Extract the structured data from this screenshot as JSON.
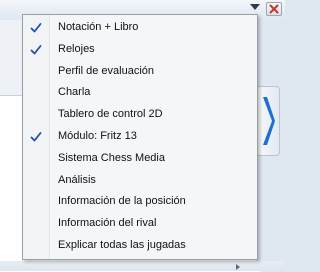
{
  "menu": {
    "items": [
      {
        "label": "Notación + Libro",
        "checked": true
      },
      {
        "label": "Relojes",
        "checked": true
      },
      {
        "label": "Perfil de evaluación",
        "checked": false
      },
      {
        "label": "Charla",
        "checked": false
      },
      {
        "label": "Tablero de control 2D",
        "checked": false
      },
      {
        "label": "Módulo: Fritz 13",
        "checked": true
      },
      {
        "label": "Sistema Chess Media",
        "checked": false
      },
      {
        "label": "Análisis",
        "checked": false
      },
      {
        "label": "Información de la posición",
        "checked": false
      },
      {
        "label": "Información del rival",
        "checked": false
      },
      {
        "label": "Explicar todas las jugadas",
        "checked": false
      }
    ]
  },
  "icons": {
    "dropdown": "chevron-down-icon",
    "close": "close-icon",
    "side_arrow": "chevron-right-icon",
    "check": "checkmark-icon"
  },
  "colors": {
    "check": "#1f4fb3",
    "close_x": "#c0392b",
    "side_arrow": "#1f6fd1"
  }
}
